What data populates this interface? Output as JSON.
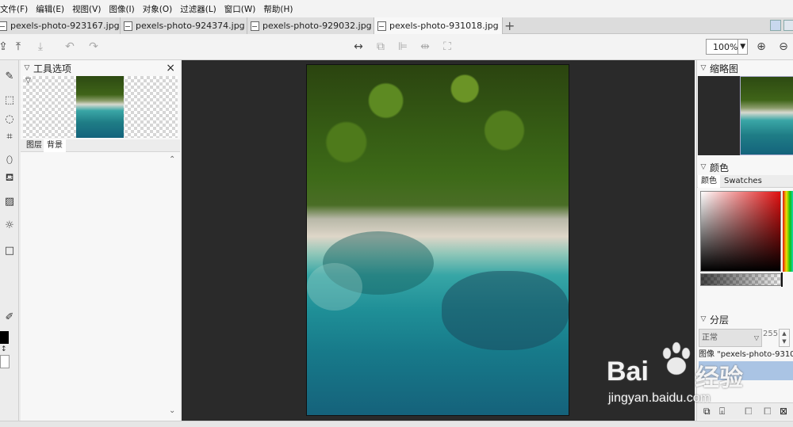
{
  "menu": [
    "文件(F)",
    "编辑(E)",
    "视图(V)",
    "图像(I)",
    "对象(O)",
    "过滤器(L)",
    "窗口(W)",
    "帮助(H)"
  ],
  "tabs": [
    {
      "label": "pexels-photo-923167.jpg"
    },
    {
      "label": "pexels-photo-924374.jpg"
    },
    {
      "label": "pexels-photo-929032.jpg"
    },
    {
      "label": "pexels-photo-931018.jpg",
      "active": true
    }
  ],
  "tab_close": "×",
  "tab_add": "+",
  "zoom": "100%",
  "tool_options": {
    "title": "工具选项",
    "close": "×",
    "subtabs": [
      "图层",
      "背景"
    ]
  },
  "navigator": {
    "title": "缩略图"
  },
  "color_panel": {
    "title": "颜色",
    "subtabs": [
      "颜色",
      "Swatches"
    ]
  },
  "layers": {
    "title": "分层",
    "blend_mode": "正常",
    "opacity": "255",
    "layer_name": "图像 \"pexels-photo-9310"
  },
  "watermark": {
    "brand": "Bai",
    "cn": "经验",
    "url": "jingyan.baidu.com"
  },
  "colors": {
    "canvas_bg": "#2a2a2a",
    "panel_bg": "#f7f7f7",
    "selection": "#aac4e4"
  }
}
